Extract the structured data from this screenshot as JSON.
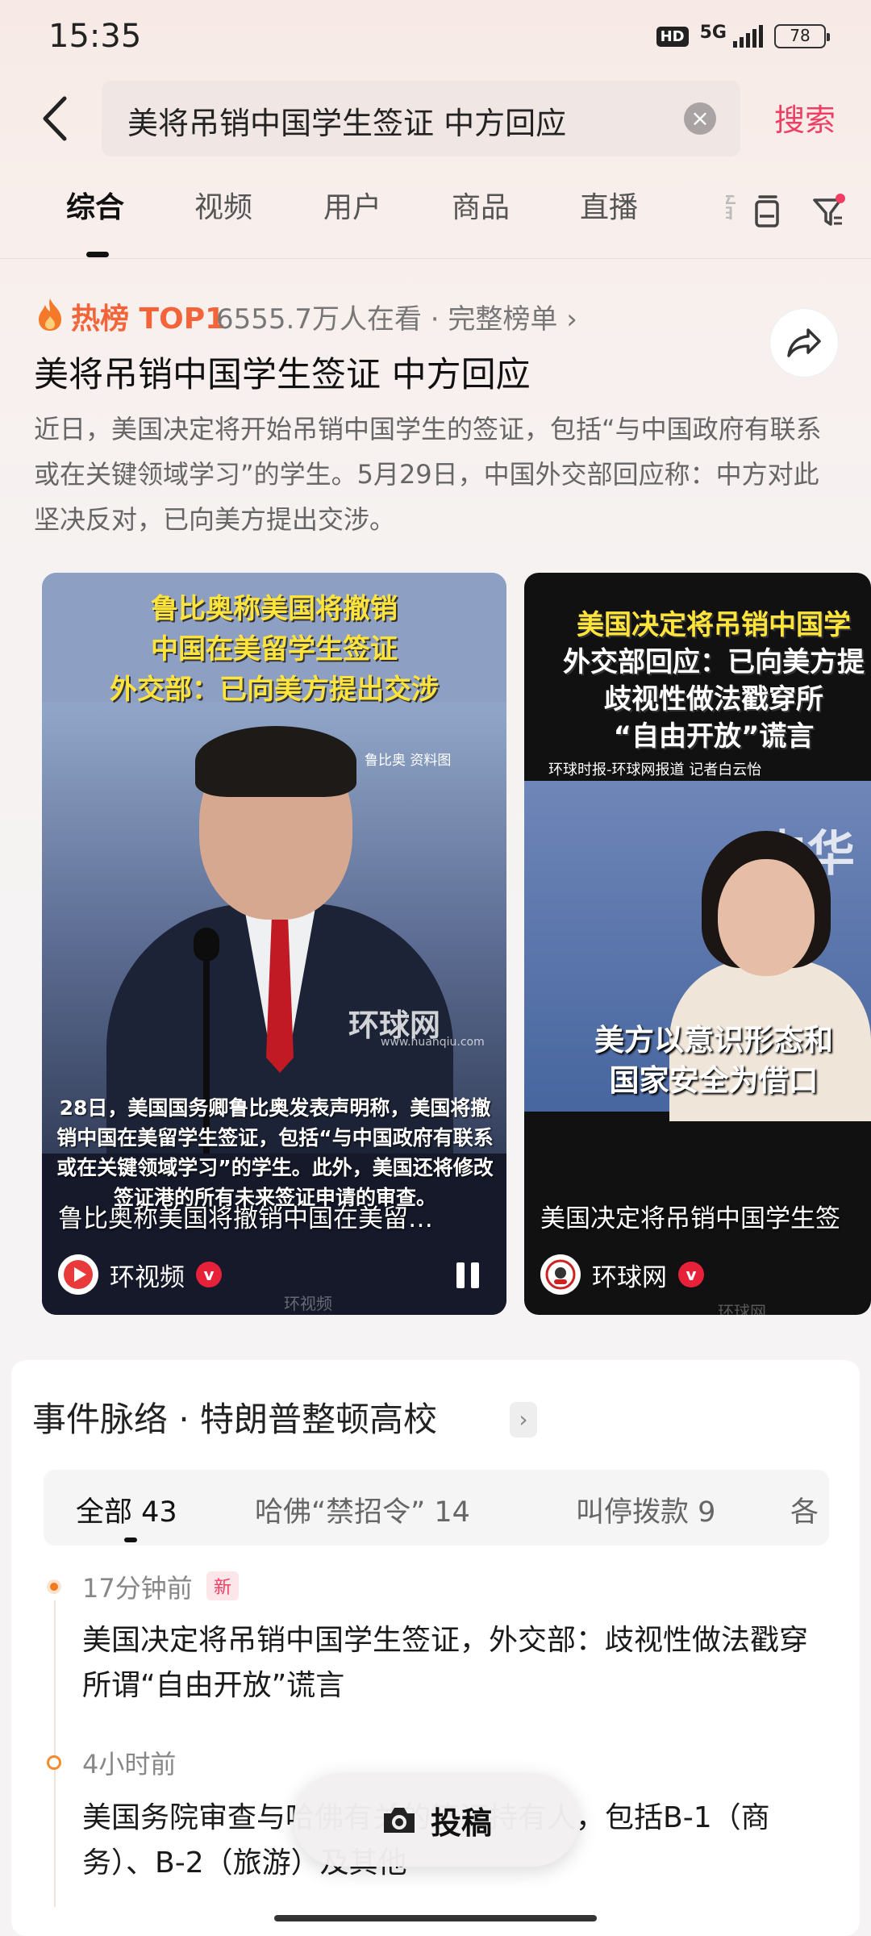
{
  "status_bar": {
    "time": "15:35",
    "hd": "HD",
    "network": "5G",
    "battery": "78"
  },
  "search": {
    "query": "美将吊销中国学生签证 中方回应",
    "button": "搜索"
  },
  "tabs": [
    {
      "label": "综合"
    },
    {
      "label": "视频"
    },
    {
      "label": "用户"
    },
    {
      "label": "商品"
    },
    {
      "label": "直播"
    },
    {
      "label": "音"
    }
  ],
  "hot": {
    "label": "热榜 TOP1",
    "viewers": "6555.7万人在看 · 完整榜单 ›",
    "title": "美将吊销中国学生签证 中方回应",
    "description": "近日，美国决定将开始吊销中国学生的签证，包括“与中国政府有联系或在关键领域学习”的学生。5月29日，中国外交部回应称：中方对此坚决反对，已向美方提出交涉。"
  },
  "videos": [
    {
      "headline_lines": [
        "鲁比奥称美国将撤销",
        "中国在美留学生签证",
        "外交部：已向美方提出交涉"
      ],
      "photo_credit": "鲁比奥 资料图",
      "watermark": "环球网",
      "watermark_url": "www.huanqiu.com",
      "subtitle": "28日，美国国务卿鲁比奥发表声明称，美国将撤销中国在美留学生签证，包括“与中国政府有联系或在关键领域学习”的学生。此外，美国还将修改签证港的所有未来签证申请的审查。",
      "title": "鲁比奥称美国将撤销中国在美留…",
      "author": "环视频",
      "bottom_watermark": "环视频"
    },
    {
      "headline_lines": [
        "美国决定将吊销中国学",
        "外交部回应：已向美方提",
        "歧视性做法戳穿所",
        "“自由开放”谎言"
      ],
      "credit": "环球时报-环球网报道 记者白云怡",
      "backdrop_text": "中华",
      "subtitle_lines": [
        "美方以意识形态和",
        "国家安全为借口"
      ],
      "title": "美国决定将吊销中国学生签",
      "author": "环球网",
      "bottom_watermark": "环球网"
    }
  ],
  "timeline": {
    "title": "事件脉络 · 特朗普整顿高校",
    "tabs": [
      "全部 43",
      "哈佛“禁招令” 14",
      "叫停拨款 9",
      "各"
    ],
    "events": [
      {
        "time": "17分钟前",
        "badge": "新",
        "text": "美国决定将吊销中国学生签证，外交部：歧视性做法戳穿所谓“自由开放”谎言"
      },
      {
        "time": "4小时前",
        "text": "美国务院审查与哈佛有关的签证持有人，包括B-1（商务）、B-2（旅游）及其他"
      }
    ]
  },
  "submit": {
    "label": "投稿"
  }
}
